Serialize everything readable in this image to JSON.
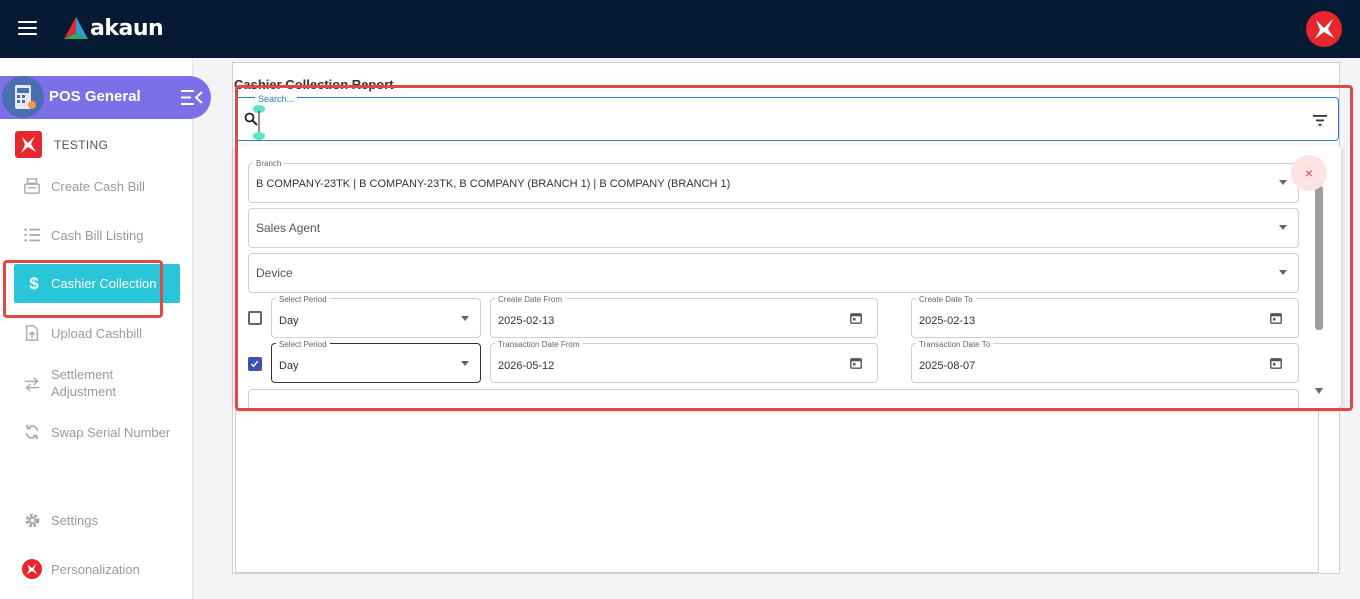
{
  "header": {
    "app_name": "akaun"
  },
  "sidebar": {
    "app_title": "POS General",
    "org_name": "TESTING",
    "items": [
      {
        "label": "Create Cash Bill",
        "icon": "cash-register-icon"
      },
      {
        "label": "Cash Bill Listing",
        "icon": "list-icon"
      },
      {
        "label": "Cashier Collection",
        "icon": "dollar-icon",
        "active": true
      },
      {
        "label": "Upload Cashbill",
        "icon": "upload-icon"
      },
      {
        "label": "Settlement",
        "label2": "Adjustment",
        "icon": "swap-arrows-icon"
      },
      {
        "label": "Swap Serial Number",
        "icon": "refresh-icon"
      }
    ],
    "bottom_items": [
      {
        "label": "Settings",
        "icon": "gear-icon"
      },
      {
        "label": "Personalization",
        "icon": "brand-icon"
      }
    ]
  },
  "main": {
    "report_title": "Cashier Collection Report",
    "search": {
      "label": "Search...",
      "value": ""
    },
    "filters": {
      "branch": {
        "label": "Branch",
        "value": "B COMPANY-23TK | B COMPANY-23TK, B COMPANY (BRANCH 1) | B COMPANY (BRANCH 1)"
      },
      "sales_agent": {
        "placeholder": "Sales Agent"
      },
      "device": {
        "placeholder": "Device"
      },
      "create_row": {
        "checked": false,
        "period_label": "Select Period",
        "period_value": "Day",
        "from_label": "Create Date From",
        "from_value": "2025-02-13",
        "to_label": "Create Date To",
        "to_value": "2025-02-13"
      },
      "transaction_row": {
        "checked": true,
        "period_label": "Select Period",
        "period_value": "Day",
        "from_label": "Transaction Date From",
        "from_value": "2026-05-12",
        "to_label": "Transaction Date To",
        "to_value": "2025-08-07"
      },
      "close_symbol": "×"
    }
  },
  "colors": {
    "topbar": "#061a33",
    "accent_purple": "#7d6fe8",
    "active_cyan": "#29c5d9",
    "highlight_red": "#e04848",
    "checkbox_blue": "#3f51b5",
    "search_blue": "#2a80c8"
  }
}
